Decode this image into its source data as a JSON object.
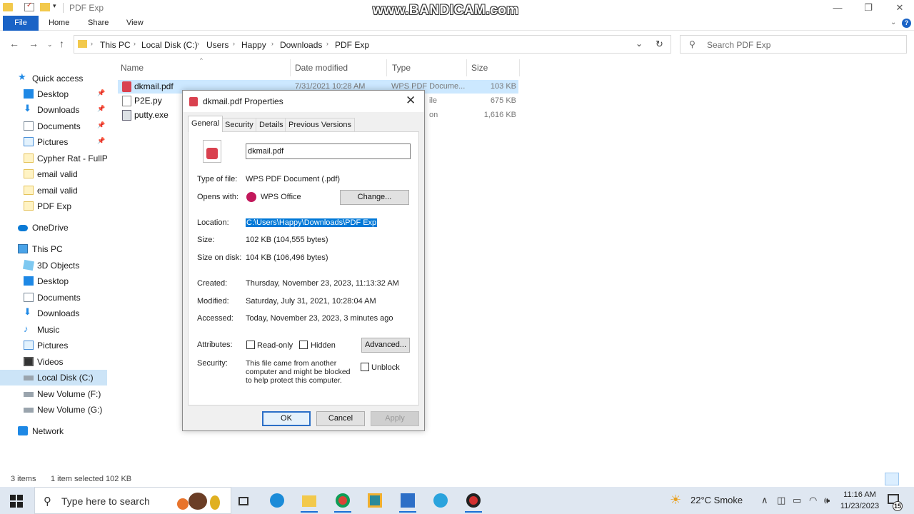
{
  "window": {
    "title": "PDF Exp",
    "watermark": "www.BANDICAM.com",
    "controls": {
      "minimize": "—",
      "maximize": "❐",
      "close": "✕"
    }
  },
  "ribbon": {
    "tabs": [
      "File",
      "Home",
      "Share",
      "View"
    ]
  },
  "address": {
    "crumbs": [
      "This PC",
      "Local Disk (C:)",
      "Users",
      "Happy",
      "Downloads",
      "PDF Exp"
    ],
    "search_placeholder": "Search PDF Exp"
  },
  "nav_pane": {
    "quick_access": "Quick access",
    "quick_items": [
      "Desktop",
      "Downloads",
      "Documents",
      "Pictures",
      "Cypher Rat - FullPa",
      "email valid",
      "email valid",
      "PDF Exp"
    ],
    "onedrive": "OneDrive",
    "this_pc": "This PC",
    "pc_items": [
      "3D Objects",
      "Desktop",
      "Documents",
      "Downloads",
      "Music",
      "Pictures",
      "Videos",
      "Local Disk (C:)",
      "New Volume (F:)",
      "New Volume (G:)"
    ],
    "network": "Network"
  },
  "file_list": {
    "columns": [
      "Name",
      "Date modified",
      "Type",
      "Size"
    ],
    "files": [
      {
        "name": "dkmail.pdf",
        "date": "7/31/2021 10:28 AM",
        "type": "WPS PDF Docume...",
        "size": "103 KB"
      },
      {
        "name": "P2E.py",
        "date": "",
        "type": "ile",
        "size": "675 KB"
      },
      {
        "name": "putty.exe",
        "date": "",
        "type": "on",
        "size": "1,616 KB"
      }
    ]
  },
  "status": {
    "items": "3 items",
    "selected": "1 item selected  102 KB"
  },
  "dialog": {
    "title": "dkmail.pdf Properties",
    "tabs": [
      "General",
      "Security",
      "Details",
      "Previous Versions"
    ],
    "filename": "dkmail.pdf",
    "type_label": "Type of file:",
    "type_value": "WPS PDF Document (.pdf)",
    "opens_label": "Opens with:",
    "opens_value": "WPS Office",
    "change_button": "Change...",
    "location_label": "Location:",
    "location_value": "C:\\Users\\Happy\\Downloads\\PDF Exp",
    "size_label": "Size:",
    "size_value": "102 KB (104,555 bytes)",
    "size_disk_label": "Size on disk:",
    "size_disk_value": "104 KB (106,496 bytes)",
    "created_label": "Created:",
    "created_value": "Thursday, November 23, 2023, 11:13:32 AM",
    "modified_label": "Modified:",
    "modified_value": "Saturday, July 31, 2021, 10:28:04 AM",
    "accessed_label": "Accessed:",
    "accessed_value": "Today, November 23, 2023, 3 minutes ago",
    "attributes_label": "Attributes:",
    "readonly_label": "Read-only",
    "hidden_label": "Hidden",
    "advanced_button": "Advanced...",
    "security_label": "Security:",
    "security_text": "This file came from another computer and might be blocked to help protect this computer.",
    "unblock_label": "Unblock",
    "ok_button": "OK",
    "cancel_button": "Cancel",
    "apply_button": "Apply"
  },
  "taskbar": {
    "search_placeholder": "Type here to search",
    "weather": "22°C  Smoke",
    "time": "11:16 AM",
    "date": "11/23/2023",
    "notification_count": "15"
  }
}
